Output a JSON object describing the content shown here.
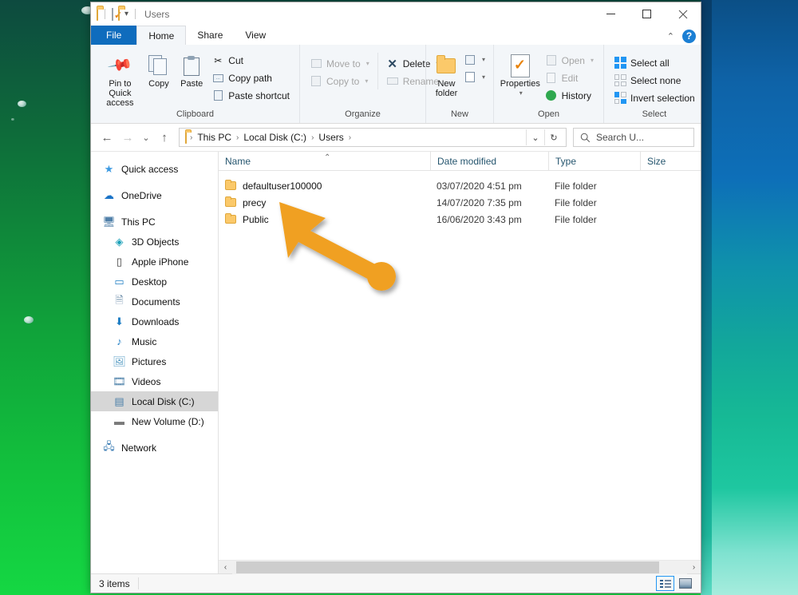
{
  "window": {
    "title": "Users",
    "quick_access": [
      "folder-icon",
      "properties-icon",
      "new-folder-icon",
      "customize-dropdown"
    ],
    "controls": {
      "minimize": "—",
      "maximize": "□",
      "close": "✕"
    },
    "ribbon_collapse": "⌃",
    "help": "?"
  },
  "tabs": [
    {
      "label": "File",
      "id": "file"
    },
    {
      "label": "Home",
      "id": "home"
    },
    {
      "label": "Share",
      "id": "share"
    },
    {
      "label": "View",
      "id": "view"
    }
  ],
  "ribbon": {
    "groups": [
      {
        "label": "Clipboard",
        "big_buttons": [
          {
            "label": "Pin to Quick\naccess",
            "line1": "Pin to Quick",
            "line2": "access",
            "icon": "pin-icon"
          },
          {
            "label": "Copy",
            "icon": "copy-icon"
          },
          {
            "label": "Paste",
            "icon": "paste-icon"
          }
        ],
        "small_buttons": [
          {
            "label": "Cut",
            "icon": "scissors-icon",
            "disabled": false
          },
          {
            "label": "Copy path",
            "icon": "copy-path-icon",
            "disabled": false
          },
          {
            "label": "Paste shortcut",
            "icon": "paste-shortcut-icon",
            "disabled": false
          }
        ]
      },
      {
        "label": "Organize",
        "small_buttons": [
          {
            "label": "Move to",
            "icon": "move-to-icon",
            "disabled": true,
            "caret": "▾"
          },
          {
            "label": "Copy to",
            "icon": "copy-to-icon",
            "disabled": true,
            "caret": "▾"
          },
          {
            "label": "Delete",
            "icon": "delete-x-icon",
            "disabled": false,
            "caret": "▾"
          },
          {
            "label": "Rename",
            "icon": "rename-icon",
            "disabled": true
          }
        ]
      },
      {
        "label": "New",
        "big_buttons": [
          {
            "label": "New\nfolder",
            "line1": "New",
            "line2": "folder",
            "icon": "new-folder-icon"
          }
        ],
        "small_buttons": [
          {
            "label": "",
            "icon": "new-item-icon",
            "caret": "▾"
          },
          {
            "label": "",
            "icon": "easy-access-icon",
            "caret": "▾"
          }
        ]
      },
      {
        "label": "Open",
        "big_buttons": [
          {
            "label": "Properties",
            "line1": "Properties",
            "line2": "▾",
            "icon": "properties-icon"
          }
        ],
        "small_buttons": [
          {
            "label": "Open",
            "icon": "open-icon",
            "disabled": true,
            "caret": "▾"
          },
          {
            "label": "Edit",
            "icon": "edit-icon",
            "disabled": true
          },
          {
            "label": "History",
            "icon": "history-icon",
            "disabled": false
          }
        ]
      },
      {
        "label": "Select",
        "small_buttons": [
          {
            "label": "Select all",
            "icon": "select-all-icon",
            "disabled": false
          },
          {
            "label": "Select none",
            "icon": "select-none-icon",
            "disabled": false
          },
          {
            "label": "Invert selection",
            "icon": "invert-selection-icon",
            "disabled": false
          }
        ]
      }
    ]
  },
  "address": {
    "back": "←",
    "forward": "→",
    "recent": "⌄",
    "up": "↑",
    "breadcrumbs": [
      "This PC",
      "Local Disk (C:)",
      "Users"
    ],
    "separator": "›",
    "history_dropdown": "⌄",
    "refresh": "↻"
  },
  "search": {
    "placeholder": "Search U...",
    "icon": "search-icon"
  },
  "sidebar": {
    "items": [
      {
        "label": "Quick access",
        "icon": "star-icon",
        "indent": false,
        "selected": false
      },
      {
        "label": "OneDrive",
        "icon": "cloud-icon",
        "indent": false,
        "selected": false
      },
      {
        "label": "This PC",
        "icon": "computer-icon",
        "indent": false,
        "selected": false
      },
      {
        "label": "3D Objects",
        "icon": "3d-objects-icon",
        "indent": true,
        "selected": false
      },
      {
        "label": "Apple iPhone",
        "icon": "phone-icon",
        "indent": true,
        "selected": false
      },
      {
        "label": "Desktop",
        "icon": "desktop-icon",
        "indent": true,
        "selected": false
      },
      {
        "label": "Documents",
        "icon": "documents-icon",
        "indent": true,
        "selected": false
      },
      {
        "label": "Downloads",
        "icon": "downloads-icon",
        "indent": true,
        "selected": false
      },
      {
        "label": "Music",
        "icon": "music-icon",
        "indent": true,
        "selected": false
      },
      {
        "label": "Pictures",
        "icon": "pictures-icon",
        "indent": true,
        "selected": false
      },
      {
        "label": "Videos",
        "icon": "videos-icon",
        "indent": true,
        "selected": false
      },
      {
        "label": "Local Disk (C:)",
        "icon": "hard-drive-icon",
        "indent": true,
        "selected": true
      },
      {
        "label": "New Volume (D:)",
        "icon": "drive-icon",
        "indent": true,
        "selected": false
      },
      {
        "label": "Network",
        "icon": "network-icon",
        "indent": false,
        "selected": false
      }
    ]
  },
  "filelist": {
    "columns": [
      {
        "label": "Name",
        "sorted": true,
        "sort_glyph": "⌃"
      },
      {
        "label": "Date modified"
      },
      {
        "label": "Type"
      },
      {
        "label": "Size"
      }
    ],
    "rows": [
      {
        "name": "defaultuser100000",
        "date": "03/07/2020 4:51 pm",
        "type": "File folder",
        "size": "",
        "icon": "folder-icon"
      },
      {
        "name": "precy",
        "date": "14/07/2020 7:35 pm",
        "type": "File folder",
        "size": "",
        "icon": "folder-icon"
      },
      {
        "name": "Public",
        "date": "16/06/2020 3:43 pm",
        "type": "File folder",
        "size": "",
        "icon": "folder-icon"
      }
    ],
    "scroll_left": "‹",
    "scroll_right": "›"
  },
  "statusbar": {
    "item_count": "3 items",
    "views": [
      {
        "name": "details-view",
        "active": true
      },
      {
        "name": "large-icons-view",
        "active": false
      }
    ]
  },
  "annotation": {
    "type": "arrow-pointer",
    "color": "#F0A020",
    "target": "precy"
  },
  "colors": {
    "accent": "#0f6cbd",
    "ribbon_bg": "#f3f6f9",
    "selection": "#d6d6d6",
    "annotation": "#F0A020"
  }
}
